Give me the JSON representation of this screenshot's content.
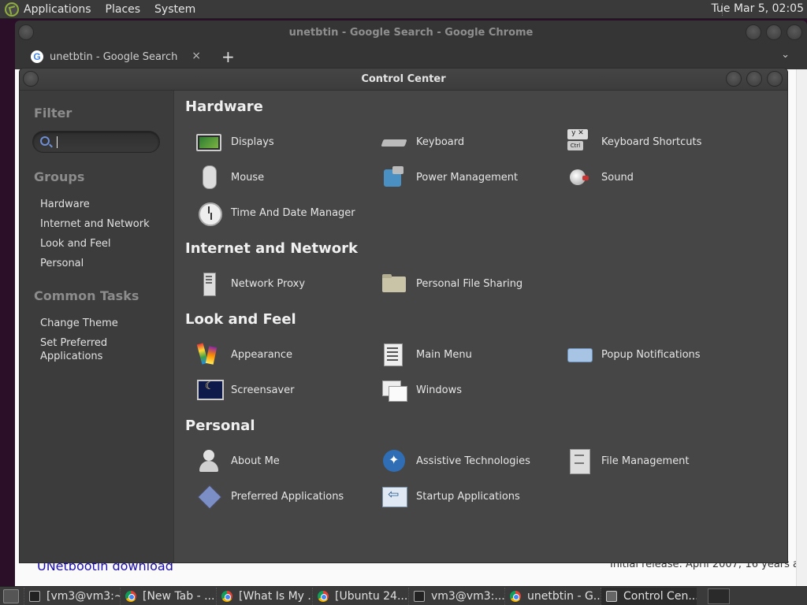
{
  "top_panel": {
    "menus": [
      "Applications",
      "Places",
      "System"
    ],
    "clock": "Tue Mar  5, 02:05"
  },
  "chrome": {
    "title": "unetbtin - Google Search - Google Chrome",
    "tab_title": "unetbtin - Google Search",
    "tab_close": "×",
    "new_tab": "+",
    "tab_search": "⌄",
    "g_letter": "G",
    "bg_link": "UNetbootin download",
    "bg_right_text": "Initial release: April 2007; 16 years a"
  },
  "control_center": {
    "title": "Control Center",
    "sidebar": {
      "filter_heading": "Filter",
      "filter_value": "",
      "groups_heading": "Groups",
      "groups": [
        "Hardware",
        "Internet and Network",
        "Look and Feel",
        "Personal"
      ],
      "tasks_heading": "Common Tasks",
      "tasks": [
        "Change Theme",
        "Set Preferred\nApplications"
      ]
    },
    "sections": [
      {
        "title": "Hardware",
        "items": [
          "Displays",
          "Keyboard",
          "Keyboard Shortcuts",
          "Mouse",
          "Power Management",
          "Sound",
          "Time And Date Manager"
        ]
      },
      {
        "title": "Internet and Network",
        "items": [
          "Network Proxy",
          "Personal File Sharing"
        ]
      },
      {
        "title": "Look and Feel",
        "items": [
          "Appearance",
          "Main Menu",
          "Popup Notifications",
          "Screensaver",
          "Windows"
        ]
      },
      {
        "title": "Personal",
        "items": [
          "About Me",
          "Assistive Technologies",
          "File Management",
          "Preferred Applications",
          "Startup Applications"
        ]
      }
    ]
  },
  "taskbar": {
    "tasks": [
      {
        "label": "[vm3@vm3:~]",
        "icon": "terminal-icon"
      },
      {
        "label": "[New Tab - ...",
        "icon": "chrome-icon"
      },
      {
        "label": "[What Is My ...",
        "icon": "chrome-icon"
      },
      {
        "label": "[Ubuntu 24....",
        "icon": "chrome-icon"
      },
      {
        "label": "vm3@vm3:...",
        "icon": "terminal-icon"
      },
      {
        "label": "unetbtin - G...",
        "icon": "chrome-icon"
      },
      {
        "label": "Control Cen...",
        "icon": "control-center-icon"
      }
    ]
  }
}
